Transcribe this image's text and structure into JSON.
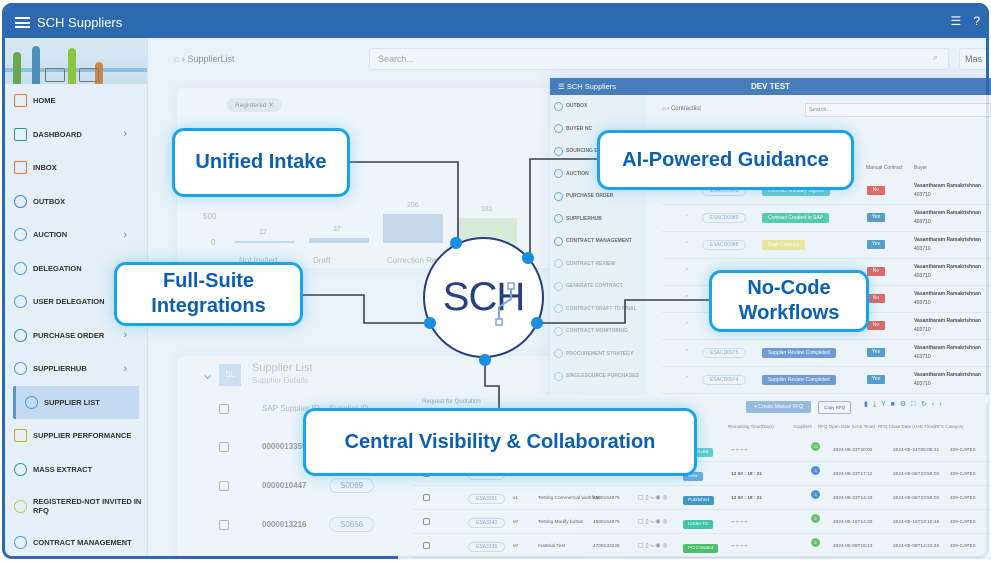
{
  "app": {
    "title": "SCH Suppliers"
  },
  "sidebar": {
    "items": [
      {
        "label": "HOME",
        "icon": "home-icon",
        "color": "#d9773b"
      },
      {
        "label": "DASHBOARD",
        "icon": "inbox-icon",
        "chevron": true,
        "color": "#2a9c94"
      },
      {
        "label": "INBOX",
        "icon": "inbox-icon",
        "color": "#d9773b"
      },
      {
        "label": "OUTBOX",
        "icon": "send-icon",
        "color": "#3b7fd3"
      },
      {
        "label": "AUCTION",
        "icon": "pie-icon",
        "chevron": true,
        "color": "#4a9fd8"
      },
      {
        "label": "DELEGATION",
        "icon": "pie-icon",
        "color": "#4a9fd8"
      },
      {
        "label": "USER DELEGATION",
        "icon": "pie-icon",
        "color": "#4a9fd8"
      },
      {
        "label": "PURCHASE ORDER",
        "icon": "pie-icon",
        "chevron": true,
        "color": "#2a9c94"
      },
      {
        "label": "SUPPLIERHUB",
        "icon": "users-icon",
        "chevron": true,
        "color": "#4a9fd8"
      },
      {
        "label": "SUPPLIER LIST",
        "icon": "users-icon",
        "active": true,
        "color": "#4a9fd8"
      },
      {
        "label": "SUPPLIER PERFORMANCE",
        "icon": "bar-chart-icon",
        "color": "#d3a526"
      },
      {
        "label": "MASS EXTRACT",
        "icon": "users-icon",
        "color": "#2a9c94"
      },
      {
        "label": "REGISTERED-NOT INVITED IN RFQ",
        "icon": "users-icon",
        "color": "#c9c94a"
      },
      {
        "label": "CONTRACT MANAGEMENT",
        "icon": "pie-icon",
        "chevron": true,
        "color": "#4a9fd8"
      }
    ]
  },
  "main": {
    "breadcrumb": "SupplierList",
    "search_placeholder": "Search...",
    "mas_button": "Mas",
    "filter_chip": "Registered",
    "chart": {
      "ytick_top": "500",
      "ytick_zero": "0",
      "bars": [
        {
          "label": "Not Invited",
          "value": "12"
        },
        {
          "label": "Draft",
          "value": "37"
        },
        {
          "label": "Correction Req.",
          "value": "206"
        },
        {
          "label": "Pending",
          "value": "181"
        }
      ]
    },
    "supplier_list": {
      "title": "Supplier List",
      "subtitle": "Supplier Details",
      "avatar": "SL",
      "columns": [
        "SAP Supplier ID",
        "Supplier ID"
      ],
      "rows": [
        {
          "sap_id": "0000013359",
          "supplier_id": ""
        },
        {
          "sap_id": "0000010447",
          "supplier_id": "S0069"
        },
        {
          "sap_id": "0000013216",
          "supplier_id": "S0656"
        }
      ]
    }
  },
  "contract_window": {
    "app_title": "SCH Suppliers",
    "env": "DEV TEST",
    "breadcrumb": "Contractlist",
    "search_placeholder": "Search...",
    "sidebar": [
      "OUTBOX",
      "BUYER NC",
      "SOURCING E",
      "AUCTION",
      "PURCHASE ORDER",
      "SUPPLIERHUB",
      "CONTRACT MANAGEMENT",
      "CONTRACT REVIEW",
      "GENERATE CONTRACT",
      "CONTRACT DRAFT TO FINAL",
      "CONTRACT MONITORING",
      "PROCUREMENT STRATEGY",
      "SINGLESOURCE PURCHASES"
    ],
    "columns": [
      "Manual Contract",
      "Buyer"
    ],
    "rows": [
      {
        "code": "ESACD0990",
        "status": "Contract Mutually Signed",
        "status_color": "#4fc3c9",
        "manual": "No",
        "buyer": "Vasantharam Ramakrishnan",
        "buyer_id": "403710"
      },
      {
        "code": "ESACD0989",
        "status": "Contract Created In SAP",
        "status_color": "#3cc6a4",
        "manual": "Yes",
        "buyer": "Vasantharam Ramakrishnan",
        "buyer_id": "403710"
      },
      {
        "code": "ESACD0988",
        "status": "Draft Contract",
        "status_color": "#e9e38a",
        "manual": "Yes",
        "buyer": "Vasantharam Ramakrishnan",
        "buyer_id": "403710"
      },
      {
        "code": "",
        "status": "",
        "status_color": "",
        "manual": "No",
        "buyer": "Vasantharam Ramakrishnan",
        "buyer_id": "403710"
      },
      {
        "code": "",
        "status": "",
        "status_color": "",
        "manual": "No",
        "buyer": "Vasantharam Ramakrishnan",
        "buyer_id": "403710"
      },
      {
        "code": "",
        "status": "",
        "status_color": "",
        "manual": "No",
        "buyer": "Vasantharam Ramakrishnan",
        "buyer_id": "403710"
      },
      {
        "code": "ESACD0975",
        "status": "Supplier Review Completed",
        "status_color": "#5a8ed0",
        "manual": "Yes",
        "buyer": "Vasantharam Ramakrishnan",
        "buyer_id": "403710"
      },
      {
        "code": "ESACD0974",
        "status": "Supplier Review Completed",
        "status_color": "#5a8ed0",
        "manual": "Yes",
        "buyer": "Vasantharam Ramakrishnan",
        "buyer_id": "403710"
      }
    ]
  },
  "rfq_window": {
    "title": "Request for Quotation",
    "create_button": "+ Create Manual RFQ",
    "copy_button": "Copy RFQ",
    "columns": [
      "Remaining Time(Days)",
      "Suppliers",
      "RFQ Open Date (UAE Time)",
      "RFQ Close Date (UAE Time)",
      "RFX Category"
    ],
    "rows": [
      {
        "code": "",
        "ver": "",
        "desc": "",
        "pr": "",
        "status": "Received",
        "status_color": "#4fc9c9",
        "remaining": "-- -- -- --",
        "suppliers": "10",
        "open": "2024-05-23T20:02",
        "close": "2024-05-24T08:08:41",
        "category": "400-CAPEX"
      },
      {
        "code": "ESA3370",
        "ver": "v0",
        "desc": "Testing RFQ Creation",
        "pr": "4509164975",
        "status": "New",
        "status_color": "#5aa3e0",
        "remaining": "12 00 : 18 : 21",
        "suppliers": "3",
        "open": "2024-05-23T17:12",
        "close": "2024-06-06T23:59:00",
        "category": "400-CAPEX"
      },
      {
        "code": "ESA3361",
        "ver": "v1",
        "desc": "Testing Commercial workflow",
        "pr": "4509164975",
        "status": "Published",
        "status_color": "#2f8fc9",
        "remaining": "12 00 : 18 : 21",
        "suppliers": "3",
        "open": "2024-05-23T14:43",
        "close": "2024-06-06T23:59:00",
        "category": "400-CAPEX"
      },
      {
        "code": "ESA3343",
        "ver": "v0",
        "desc": "Testing Modify button",
        "pr": "4509164975",
        "status": "Under TE",
        "status_color": "#2fc0a0",
        "remaining": "-- -- -- --",
        "suppliers": "2",
        "open": "2024-05-16T14:33",
        "close": "2024-05-16T13:10:49",
        "category": "400-CAPEX"
      },
      {
        "code": "ESA3336",
        "ver": "v0",
        "desc": "material Test",
        "pr": "4709133226",
        "status": "PO Created",
        "status_color": "#3cba5c",
        "remaining": "-- -- -- --",
        "suppliers": "2",
        "open": "2024-05-09T15:13",
        "close": "2024-05-09T14:22:28",
        "category": "400-CAPEX"
      }
    ]
  },
  "callouts": {
    "unified_intake": "Unified Intake",
    "ai_guidance": "AI-Powered Guidance",
    "integrations_line1": "Full-Suite",
    "integrations_line2": "Integrations",
    "nocode_line1": "No-Code",
    "nocode_line2": "Workflows",
    "visibility": "Central Visibility & Collaboration"
  },
  "logo": {
    "text": "SCH"
  },
  "colors": {
    "header": "#2c69b1",
    "callout_border": "#1aa3e8",
    "callout_text": "#0a5fb4",
    "logo": "#263f80",
    "connector": "#3a3f4a",
    "dot": "#1a8fe0"
  }
}
